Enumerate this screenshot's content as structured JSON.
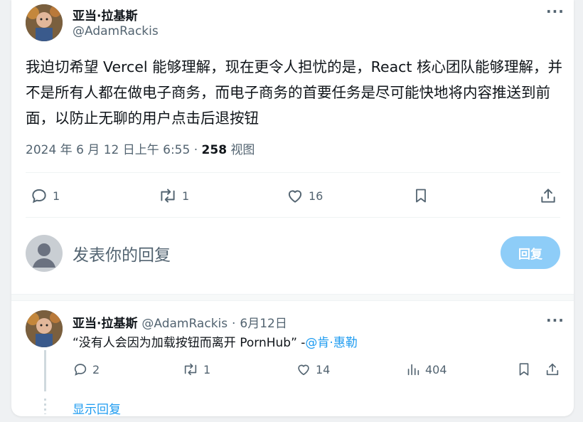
{
  "tweet": {
    "author_name": "亚当·拉基斯",
    "author_handle": "@AdamRackis",
    "text": "我迫切希望 Vercel 能够理解，现在更令人担忧的是，React 核心团队能够理解，并不是所有人都在做电子商务，而电子商务的首要任务是尽可能快地将内容推送到前面，以防止无聊的用户点击后退按钮",
    "timestamp": "2024 年 6 月 12 日上午 6:55",
    "views_count": "258",
    "views_label": "视图",
    "dot": "·",
    "actions": {
      "replies": "1",
      "retweets": "1",
      "likes": "16"
    }
  },
  "composer": {
    "placeholder": "发表你的回复",
    "reply_button": "回复"
  },
  "thread_reply": {
    "author_name": "亚当·拉基斯",
    "author_handle": "@AdamRackis",
    "dot": "·",
    "date": "6月12日",
    "text": "“没有人会因为加载按钮而离开 PornHub” -",
    "mention": "@肯·惠勒",
    "actions": {
      "replies": "2",
      "retweets": "1",
      "likes": "14",
      "views": "404"
    },
    "show_replies": "显示回复"
  },
  "more_glyph": "···",
  "colors": {
    "accent": "#1d9bf0",
    "reply_button_disabled": "#8ecdf8",
    "secondary_text": "#536471"
  }
}
